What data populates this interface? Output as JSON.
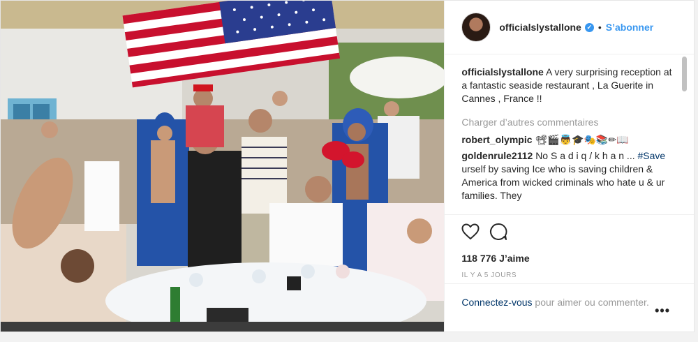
{
  "header": {
    "username": "officialslystallone",
    "separator": "•",
    "follow_label": "S’abonner"
  },
  "caption": {
    "username": "officialslystallone",
    "text": "A very surprising reception at a fantastic seaside restaurant , La Guerite in Cannes , France !!"
  },
  "load_more_label": "Charger d’autres commentaires",
  "comments": [
    {
      "username": "robert_olympic",
      "text": "📽🎬👼🎓🎭📚✏📖"
    },
    {
      "username": "goldenrule2112",
      "text": "No S a d i q / k h a n ...",
      "hashtag": "#Save",
      "text2": " urself by saving Ice who is saving children & America from wicked criminals who hate u & ur families. They"
    }
  ],
  "likes": "118 776 J’aime",
  "time_ago": "IL Y A 5 JOURS",
  "login": {
    "link": "Connectez-vous",
    "rest": " pour aimer ou commenter."
  },
  "more_label": "•••",
  "icons": {
    "like": "heart-icon",
    "comment": "comment-bubble-icon",
    "verified": "verified-badge-icon"
  },
  "colors": {
    "accent": "#3897f0",
    "link": "#003569",
    "muted": "#999999"
  }
}
